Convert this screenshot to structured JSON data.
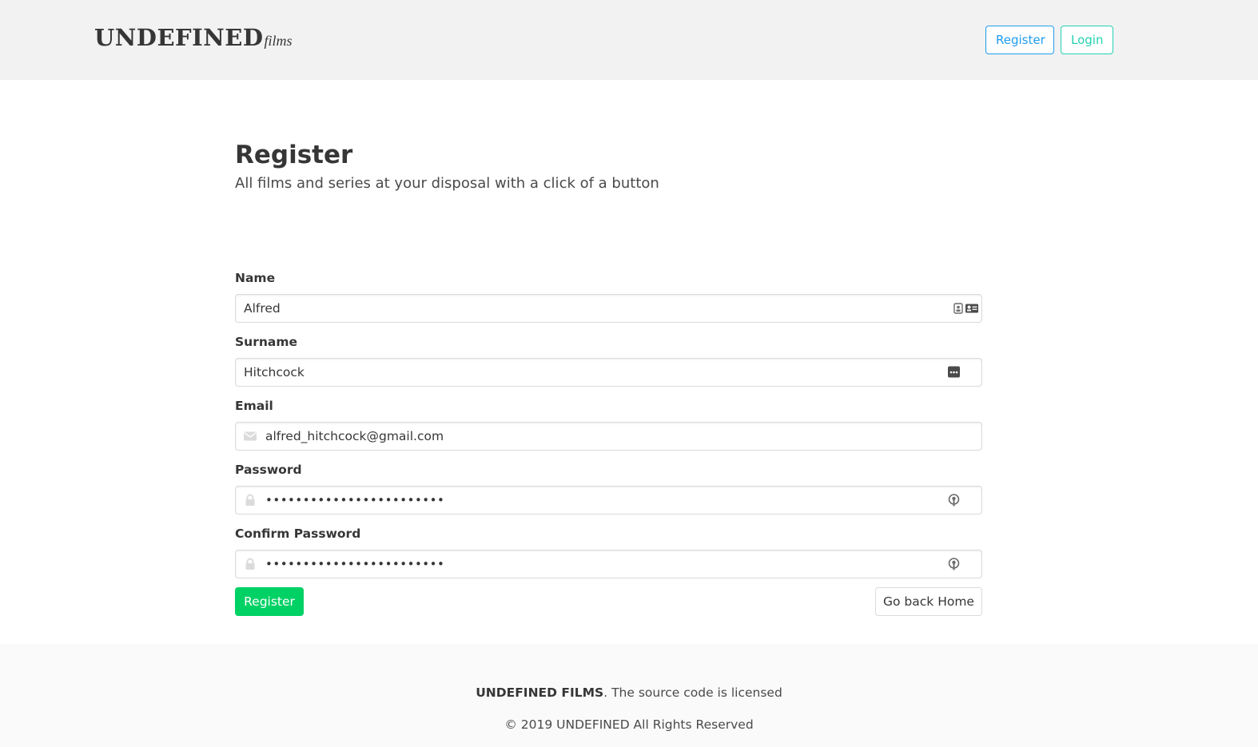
{
  "header": {
    "brand_main": "UNDEFINED",
    "brand_sub": "films",
    "register_label": "Register",
    "login_label": "Login"
  },
  "hero": {
    "title": "Register",
    "subtitle": "All films and series at your disposal with a click of a button"
  },
  "form": {
    "name": {
      "label": "Name",
      "value": "Alfred"
    },
    "surname": {
      "label": "Surname",
      "value": "Hitchcock"
    },
    "email": {
      "label": "Email",
      "value": "alfred_hitchcock@gmail.com"
    },
    "password": {
      "label": "Password",
      "value": "••••••••••••••••••••••••"
    },
    "confirm_password": {
      "label": "Confirm Password",
      "value": "••••••••••••••••••••••••"
    },
    "submit_label": "Register",
    "home_label": "Go back Home"
  },
  "footer": {
    "brand": "UNDEFINED FILMS",
    "license_text": ". The source code is licensed",
    "copyright": "© 2019 UNDEFINED All Rights Reserved"
  },
  "colors": {
    "navbar_bg": "#f2f2f2",
    "register_nav": "#209cee",
    "login_nav": "#23d1b2",
    "submit_bg": "#00d165",
    "footer_bg": "#fafafa"
  },
  "icons": {
    "name_field": "contact-card-icon",
    "surname_field": "autofill-dots-icon",
    "email_field": "envelope-icon",
    "password_field": "lock-icon",
    "password_manager": "key-icon"
  }
}
